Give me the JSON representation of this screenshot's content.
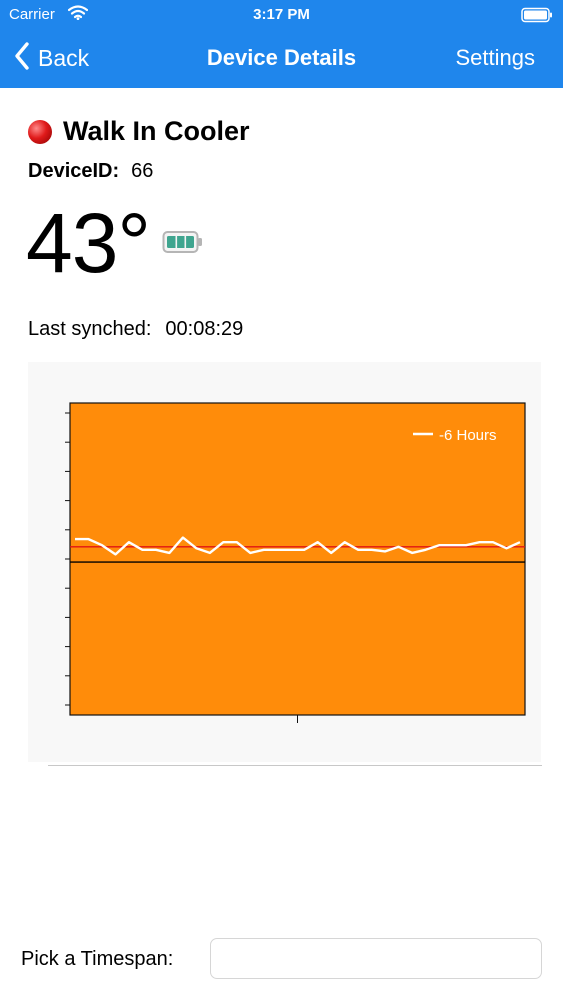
{
  "status_bar": {
    "carrier": "Carrier",
    "time": "3:17 PM"
  },
  "nav": {
    "back_label": "Back",
    "title": "Device Details",
    "settings_label": "Settings"
  },
  "device": {
    "name": "Walk In Cooler",
    "id_label": "DeviceID:",
    "id_value": "66",
    "temperature": "43°",
    "status_color": "#e01a1a",
    "battery_level": 1.0,
    "last_synched_label": "Last synched:",
    "last_synched_value": "00:08:29"
  },
  "timespan": {
    "label": "Pick a Timespan:",
    "value": ""
  },
  "colors": {
    "accent": "#1f86ec",
    "chart_bg": "#ff8c0a",
    "series": "#ffffff",
    "threshold": "#e31414",
    "baseline": "#000000"
  },
  "chart_data": {
    "type": "line",
    "series": [
      {
        "name": "-6 Hours",
        "values": [
          51,
          51,
          47,
          41,
          49,
          44,
          44,
          42,
          52,
          45,
          42,
          49,
          49,
          42,
          44,
          44,
          44,
          44,
          49,
          42,
          49,
          44,
          44,
          43,
          46,
          42,
          44,
          47,
          47,
          47,
          49,
          49,
          45,
          49
        ]
      }
    ],
    "reference_lines": [
      {
        "value": 46,
        "color": "#e31414"
      },
      {
        "value": 36,
        "color": "#000000"
      }
    ],
    "ylim": [
      -64,
      140
    ],
    "y_ticks": 11,
    "x_ticks": 1,
    "grid": false,
    "legend": "top-right"
  }
}
